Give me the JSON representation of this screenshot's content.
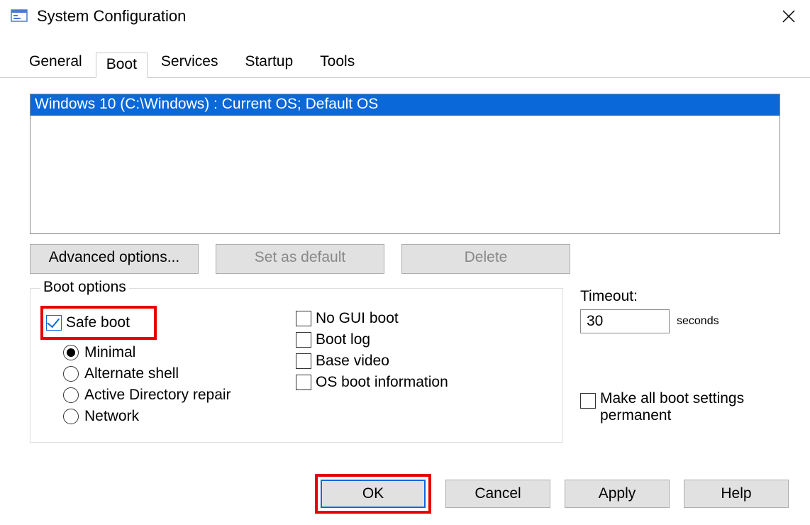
{
  "window": {
    "title": "System Configuration"
  },
  "tabs": {
    "general": "General",
    "boot": "Boot",
    "services": "Services",
    "startup": "Startup",
    "tools": "Tools",
    "active": "Boot"
  },
  "oslist": {
    "item0": "Windows 10 (C:\\Windows) : Current OS; Default OS"
  },
  "buttons": {
    "advanced": "Advanced options...",
    "setdefault": "Set as default",
    "delete": "Delete"
  },
  "bootoptions": {
    "legend": "Boot options",
    "safeboot": "Safe boot",
    "minimal": "Minimal",
    "altshell": "Alternate shell",
    "adrepair": "Active Directory repair",
    "network": "Network",
    "nogui": "No GUI boot",
    "bootlog": "Boot log",
    "basevideo": "Base video",
    "osbootinfo": "OS boot information"
  },
  "timeout": {
    "label": "Timeout:",
    "value": "30",
    "suffix": "seconds",
    "makeperm": "Make all boot settings permanent"
  },
  "dlg": {
    "ok": "OK",
    "cancel": "Cancel",
    "apply": "Apply",
    "help": "Help"
  }
}
